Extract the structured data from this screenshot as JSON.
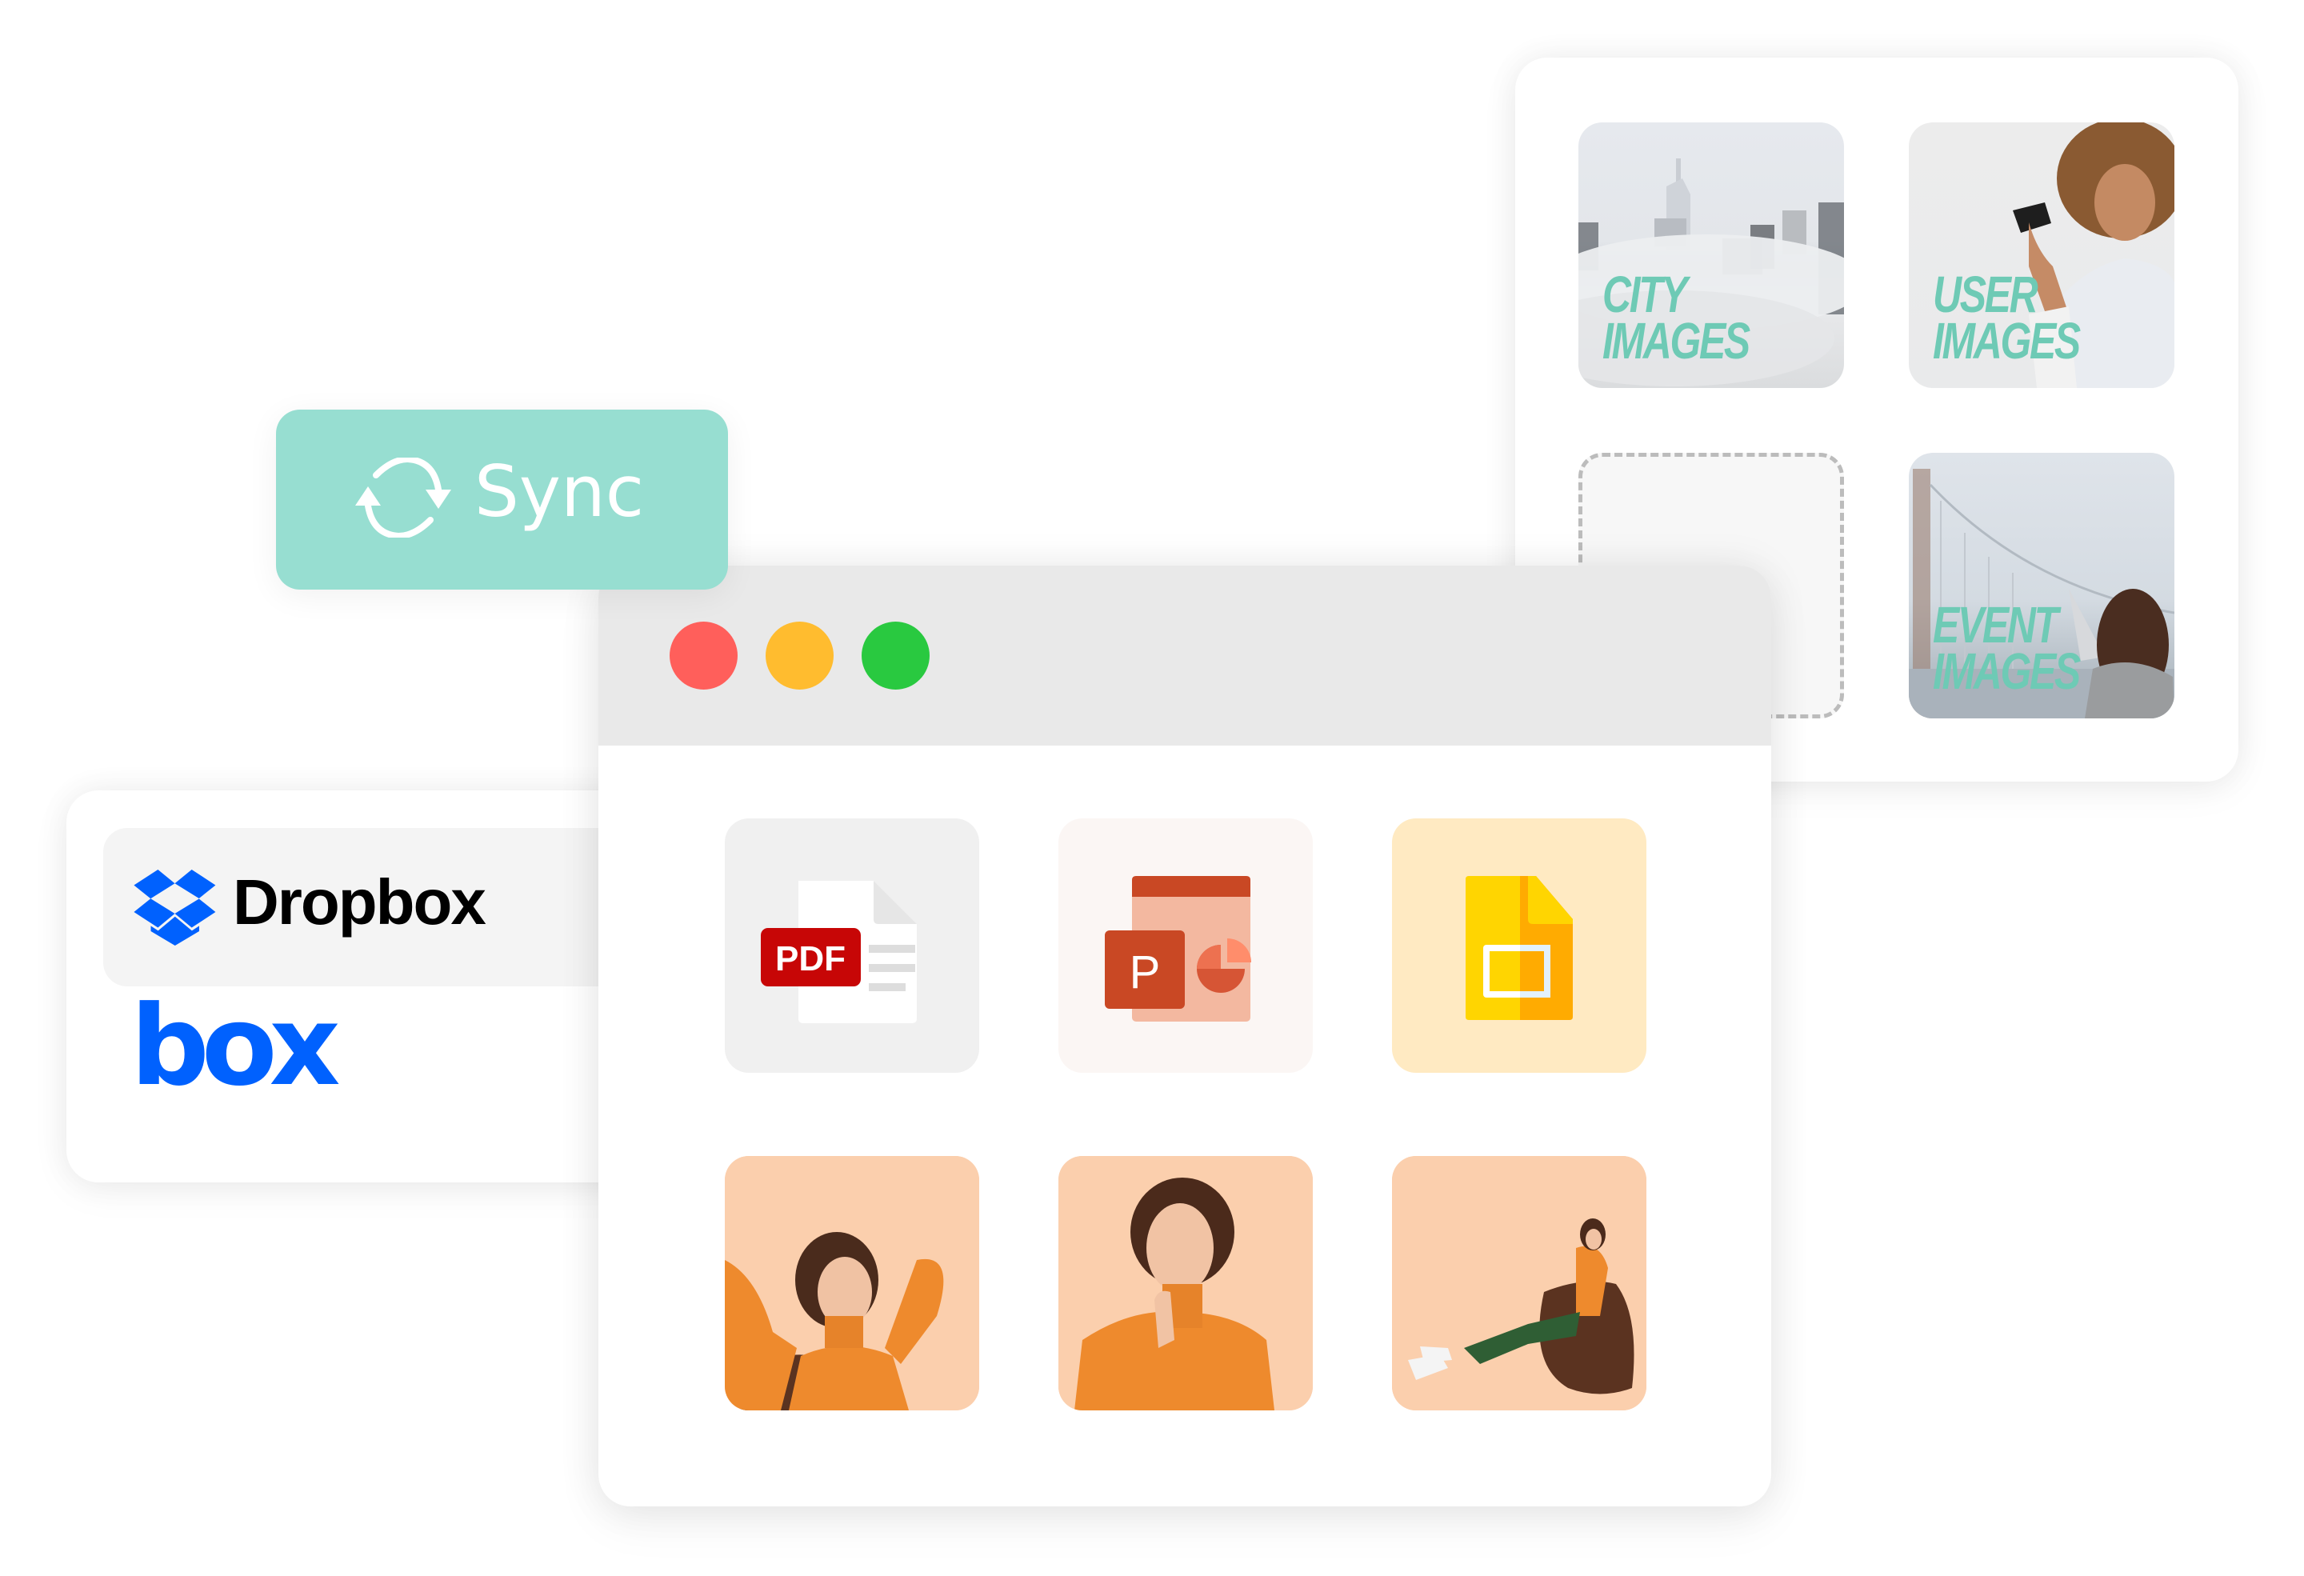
{
  "sync_button": {
    "label": "Sync",
    "icon": "sync-icon",
    "color": "#97ded1"
  },
  "cloud_providers": [
    {
      "name": "Dropbox",
      "icon": "dropbox-logo-icon",
      "selected": true,
      "brand_color": "#0061fe"
    },
    {
      "name": "box",
      "icon": "box-logo-icon",
      "selected": false,
      "brand_color": "#0061fe"
    }
  ],
  "browser_window": {
    "window_controls": [
      {
        "name": "close",
        "color": "#ff5f5b"
      },
      {
        "name": "minimize",
        "color": "#ffbc2f"
      },
      {
        "name": "maximize",
        "color": "#29c940"
      }
    ],
    "files": [
      {
        "type": "pdf",
        "icon": "pdf-file-icon",
        "badge": "PDF"
      },
      {
        "type": "powerpoint",
        "icon": "powerpoint-file-icon",
        "badge": "P"
      },
      {
        "type": "google-slides",
        "icon": "google-slides-file-icon"
      },
      {
        "type": "image",
        "icon": "photo-woman-relaxing-icon"
      },
      {
        "type": "image",
        "icon": "photo-woman-thinking-icon"
      },
      {
        "type": "image",
        "icon": "photo-woman-beanbag-icon"
      }
    ]
  },
  "image_library": {
    "accent_color": "#6ecab5",
    "folders": [
      {
        "line1": "City",
        "line2": "Images"
      },
      {
        "line1": "User",
        "line2": "Images"
      },
      {
        "line1": "",
        "line2": "",
        "placeholder": true
      },
      {
        "line1": "Event",
        "line2": "Images"
      }
    ]
  }
}
